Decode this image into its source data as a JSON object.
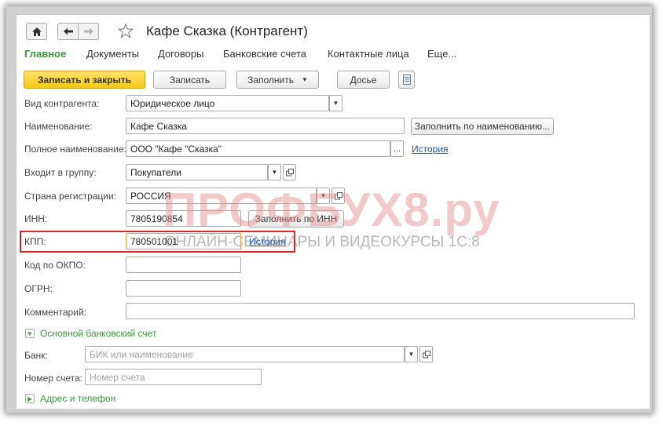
{
  "window": {
    "title": "Кафе Сказка (Контрагент)"
  },
  "icons": {
    "home": "home-icon",
    "back": "arrow-left-icon",
    "forward": "arrow-right-icon",
    "star": "star-icon",
    "list": "document-list-icon"
  },
  "nav": {
    "items": [
      "Главное",
      "Документы",
      "Договоры",
      "Банковские счета",
      "Контактные лица",
      "Еще..."
    ]
  },
  "toolbar": {
    "save_close": "Записать и закрыть",
    "save": "Записать",
    "fill": "Заполнить",
    "dossier": "Досье"
  },
  "form": {
    "kind": {
      "label": "Вид контрагента:",
      "value": "Юридическое лицо"
    },
    "name": {
      "label": "Наименование:",
      "value": "Кафе Сказка",
      "fill_btn": "Заполнить по наименованию..."
    },
    "full_name": {
      "label": "Полное наименование:",
      "value": "ООО \"Кафе \"Сказка\"",
      "ellipsis": "...",
      "history": "История"
    },
    "group": {
      "label": "Входит в группу:",
      "value": "Покупатели"
    },
    "country": {
      "label": "Страна регистрации:",
      "value": "РОССИЯ"
    },
    "inn": {
      "label": "ИНН:",
      "value": "7805190854",
      "fill_btn": "Заполнить по ИНН"
    },
    "kpp": {
      "label": "КПП:",
      "value": "780501001",
      "history": "История"
    },
    "okpo": {
      "label": "Код по ОКПО:",
      "value": ""
    },
    "ogrn": {
      "label": "ОГРН:",
      "value": ""
    },
    "comment": {
      "label": "Комментарий:",
      "value": ""
    }
  },
  "bank_section": {
    "title": "Основной банковский счет",
    "bank": {
      "label": "Банк:",
      "placeholder": "БИК или наименование"
    },
    "account": {
      "label": "Номер счета:",
      "placeholder": "Номер счета"
    }
  },
  "address_section": {
    "title": "Адрес и телефон"
  },
  "watermark": {
    "main": "ПРОФБУХ8.ру",
    "sub": "ОНЛАЙН-СЕМИНАРЫ И ВИДЕОКУРСЫ 1С:8"
  },
  "colors": {
    "accent_green": "#3a9a3a",
    "primary_yellow": "#f5c816",
    "highlight_red": "#d9262a",
    "link_blue": "#1f56a6"
  }
}
